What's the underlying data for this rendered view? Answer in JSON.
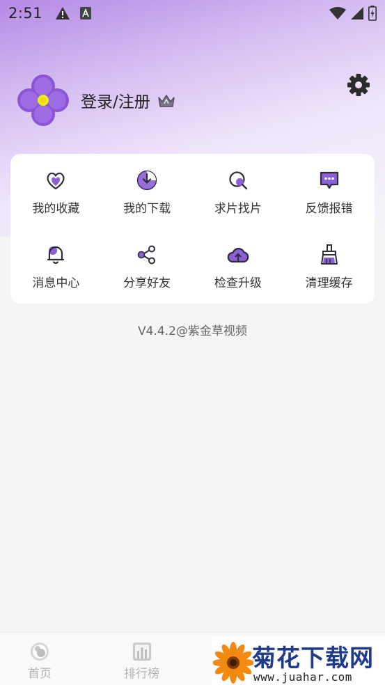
{
  "status_bar": {
    "time": "2:51",
    "left_icons": [
      "warning-icon",
      "app-a-icon"
    ],
    "right_icons": [
      "wifi-icon",
      "signal-icon",
      "battery-charging-icon"
    ]
  },
  "profile": {
    "login_label": "登录/注册",
    "avatar_icon": "purple-flower-icon",
    "vip_icon": "crown-icon"
  },
  "settings_icon": "gear-icon",
  "menu": {
    "items": [
      {
        "label": "我的收藏",
        "icon": "heart-icon"
      },
      {
        "label": "我的下载",
        "icon": "download-icon"
      },
      {
        "label": "求片找片",
        "icon": "search-film-icon"
      },
      {
        "label": "反馈报错",
        "icon": "feedback-icon"
      },
      {
        "label": "消息中心",
        "icon": "bell-icon"
      },
      {
        "label": "分享好友",
        "icon": "share-icon"
      },
      {
        "label": "检查升级",
        "icon": "cloud-upload-icon"
      },
      {
        "label": "清理缓存",
        "icon": "brush-icon"
      }
    ]
  },
  "version_text": "V4.4.2@紫金草视频",
  "bottom_nav": {
    "items": [
      {
        "label": "首页",
        "icon": "home-icon"
      },
      {
        "label": "排行榜",
        "icon": "ranking-icon"
      }
    ]
  },
  "watermark": {
    "title": "菊花下载网",
    "url": "www.juahar.com"
  },
  "colors": {
    "accent": "#8b5fd6",
    "hero_top": "#b489e6",
    "background": "#f5f4f7",
    "watermark_blue": "#1f3b8a"
  }
}
